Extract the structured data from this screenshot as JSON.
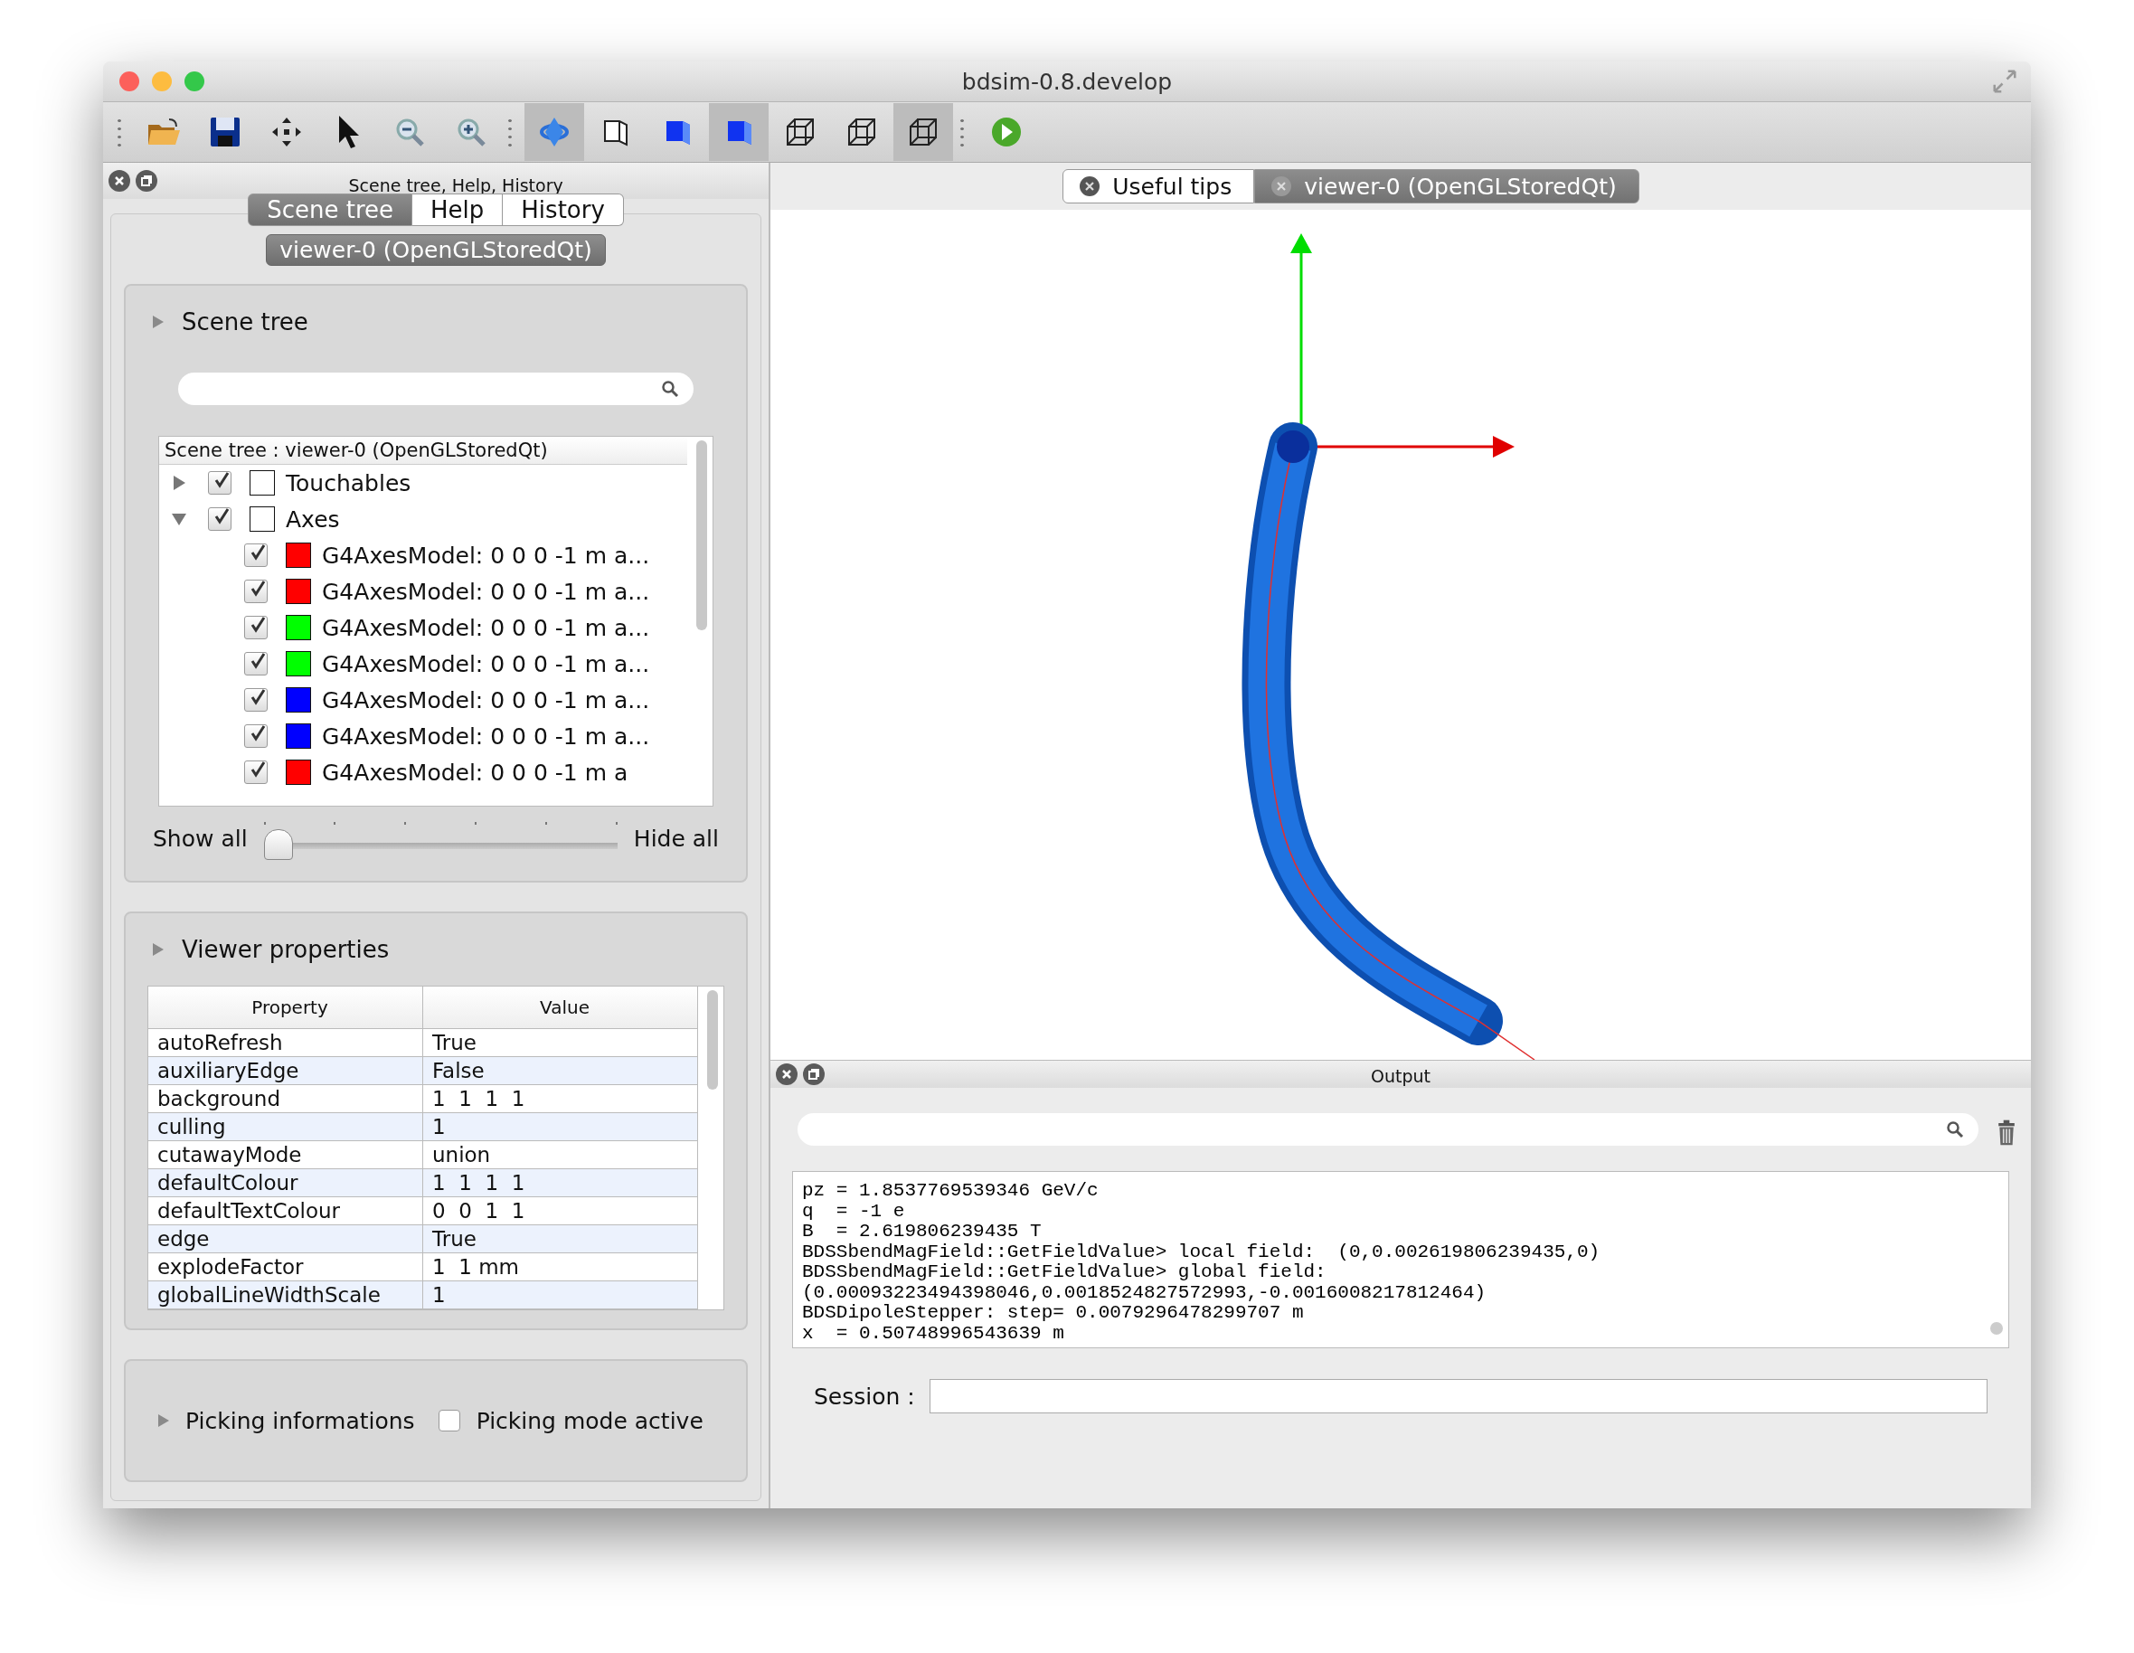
{
  "window": {
    "title": "bdsim-0.8.develop"
  },
  "toolbar": {
    "buttons": [
      {
        "selected": false
      },
      {
        "selected": false
      },
      {
        "selected": false
      },
      {
        "selected": false
      },
      {
        "selected": false
      },
      {
        "selected": false
      },
      {
        "selected": true
      },
      {
        "selected": false
      },
      {
        "selected": false
      },
      {
        "selected": true
      },
      {
        "selected": false
      },
      {
        "selected": false
      },
      {
        "selected": true
      },
      {
        "selected": false
      }
    ]
  },
  "left_dock": {
    "title": "Scene tree, Help, History",
    "tabs": [
      {
        "label": "Scene tree",
        "selected": true
      },
      {
        "label": "Help",
        "selected": false
      },
      {
        "label": "History",
        "selected": false
      }
    ],
    "viewer_button": "viewer-0 (OpenGLStoredQt)",
    "scene_tree": {
      "title": "Scene tree",
      "header": "Scene tree : viewer-0 (OpenGLStoredQt)",
      "items": [
        {
          "label": "Touchables",
          "checked": true,
          "expanded": false
        },
        {
          "label": "Axes",
          "checked": true,
          "expanded": true,
          "children": [
            {
              "label": "G4AxesModel: 0 0 0 -1 m a...",
              "checked": true,
              "color": "#ff0000"
            },
            {
              "label": "G4AxesModel: 0 0 0 -1 m a...",
              "checked": true,
              "color": "#ff0000"
            },
            {
              "label": "G4AxesModel: 0 0 0 -1 m a...",
              "checked": true,
              "color": "#00ff00"
            },
            {
              "label": "G4AxesModel: 0 0 0 -1 m a...",
              "checked": true,
              "color": "#00ff00"
            },
            {
              "label": "G4AxesModel: 0 0 0 -1 m a...",
              "checked": true,
              "color": "#0000ff"
            },
            {
              "label": "G4AxesModel: 0 0 0 -1 m a...",
              "checked": true,
              "color": "#0000ff"
            },
            {
              "label": "G4AxesModel: 0 0 0 -1 m a",
              "checked": true,
              "color": "#ff0000"
            }
          ]
        }
      ],
      "slider": {
        "min_label": "Show all",
        "max_label": "Hide all",
        "level": 0
      }
    },
    "viewer_properties": {
      "title": "Viewer properties",
      "columns": [
        "Property",
        "Value"
      ],
      "rows": [
        [
          "autoRefresh",
          "True"
        ],
        [
          "auxiliaryEdge",
          "False"
        ],
        [
          "background",
          "1  1  1  1"
        ],
        [
          "culling",
          "1"
        ],
        [
          "cutawayMode",
          "union"
        ],
        [
          "defaultColour",
          "1  1  1  1"
        ],
        [
          "defaultTextColour",
          "0  0  1  1"
        ],
        [
          "edge",
          "True"
        ],
        [
          "explodeFactor",
          "1  1 mm"
        ],
        [
          "globalLineWidthScale",
          "1"
        ]
      ]
    },
    "picking": {
      "title": "Picking informations",
      "checkbox": {
        "label": "Picking mode active",
        "checked": false
      }
    }
  },
  "viewer_tabs": [
    {
      "label": "Useful tips",
      "selected": false
    },
    {
      "label": "viewer-0 (OpenGLStoredQt)",
      "selected": true
    }
  ],
  "output": {
    "title": "Output",
    "lines": [
      "pz = 1.8537769539346 GeV/c",
      "q  = -1 e",
      "B  = 2.619806239435 T",
      "BDSSbendMagField::GetFieldValue> local field:  (0,0.002619806239435,0)",
      "BDSSbendMagField::GetFieldValue> global field:",
      "(0.00093223494398046,0.0018524827572993,-0.0016008217812464)",
      "BDSDipoleStepper: step= 0.0079296478299707 m",
      "x  = 0.50748996543639 m"
    ],
    "session_label": "Session :"
  }
}
